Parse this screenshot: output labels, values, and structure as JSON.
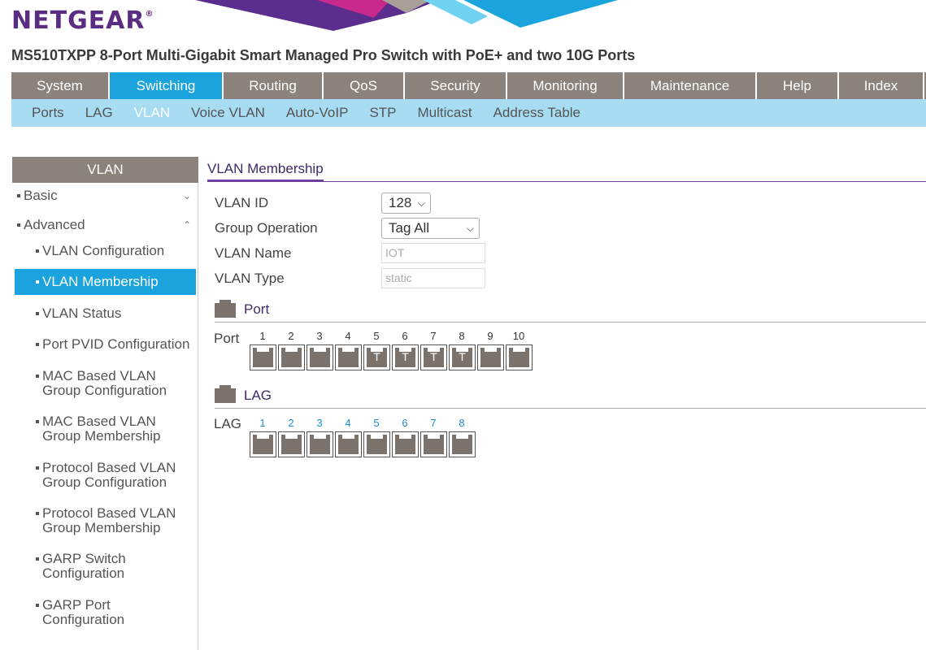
{
  "brand": {
    "logo_text": "NETGEAR",
    "trademark": "®",
    "logo_color": "#5a2d82"
  },
  "product_title": "MS510TXPP 8-Port Multi-Gigabit Smart Managed Pro Switch with PoE+ and two 10G Ports",
  "main_nav": {
    "tabs": [
      {
        "label": "System"
      },
      {
        "label": "Switching",
        "active": true
      },
      {
        "label": "Routing"
      },
      {
        "label": "QoS"
      },
      {
        "label": "Security"
      },
      {
        "label": "Monitoring"
      },
      {
        "label": "Maintenance"
      },
      {
        "label": "Help"
      },
      {
        "label": "Index"
      }
    ]
  },
  "sub_nav": {
    "items": [
      {
        "label": "Ports"
      },
      {
        "label": "LAG"
      },
      {
        "label": "VLAN",
        "active": true
      },
      {
        "label": "Voice VLAN"
      },
      {
        "label": "Auto-VoIP"
      },
      {
        "label": "STP"
      },
      {
        "label": "Multicast"
      },
      {
        "label": "Address Table"
      }
    ]
  },
  "sidebar": {
    "header": "VLAN",
    "groups": [
      {
        "label": "Basic",
        "icon": "chevron-down-icon"
      },
      {
        "label": "Advanced",
        "icon": "chevron-up-icon"
      }
    ],
    "items": [
      {
        "line1": "VLAN Configuration",
        "line2": ""
      },
      {
        "line1": "VLAN Membership",
        "line2": "",
        "active": true
      },
      {
        "line1": "VLAN Status",
        "line2": ""
      },
      {
        "line1": "Port PVID Configuration",
        "line2": ""
      },
      {
        "line1": "MAC Based VLAN",
        "line2": "Group Configuration"
      },
      {
        "line1": "MAC Based VLAN",
        "line2": "Group Membership"
      },
      {
        "line1": "Protocol Based VLAN",
        "line2": "Group Configuration"
      },
      {
        "line1": "Protocol Based VLAN",
        "line2": "Group Membership"
      },
      {
        "line1": "GARP Switch",
        "line2": "Configuration"
      },
      {
        "line1": "GARP Port",
        "line2": "Configuration"
      }
    ]
  },
  "content": {
    "section_title": "VLAN Membership",
    "form": {
      "vlan_id_label": "VLAN ID",
      "vlan_id_value": "128",
      "group_operation_label": "Group Operation",
      "group_operation_value": "Tag All",
      "vlan_name_label": "VLAN Name",
      "vlan_name_value": "IOT",
      "vlan_type_label": "VLAN Type",
      "vlan_type_value": "static"
    },
    "port_group": {
      "title": "Port",
      "row_label": "Port",
      "ports": [
        {
          "num": "1",
          "tag": ""
        },
        {
          "num": "2",
          "tag": ""
        },
        {
          "num": "3",
          "tag": ""
        },
        {
          "num": "4",
          "tag": ""
        },
        {
          "num": "5",
          "tag": "T"
        },
        {
          "num": "6",
          "tag": "T"
        },
        {
          "num": "7",
          "tag": "T"
        },
        {
          "num": "8",
          "tag": "T"
        },
        {
          "num": "9",
          "tag": ""
        },
        {
          "num": "10",
          "tag": ""
        }
      ]
    },
    "lag_group": {
      "title": "LAG",
      "row_label": "LAG",
      "lags": [
        {
          "num": "1",
          "tag": ""
        },
        {
          "num": "2",
          "tag": ""
        },
        {
          "num": "3",
          "tag": ""
        },
        {
          "num": "4",
          "tag": ""
        },
        {
          "num": "5",
          "tag": ""
        },
        {
          "num": "6",
          "tag": ""
        },
        {
          "num": "7",
          "tag": ""
        },
        {
          "num": "8",
          "tag": ""
        }
      ]
    }
  },
  "colors": {
    "nav_gray": "#8b827b",
    "accent_blue": "#1aa3dd",
    "subnav_blue": "#a7dcf2",
    "purple": "#6b3fa0"
  }
}
